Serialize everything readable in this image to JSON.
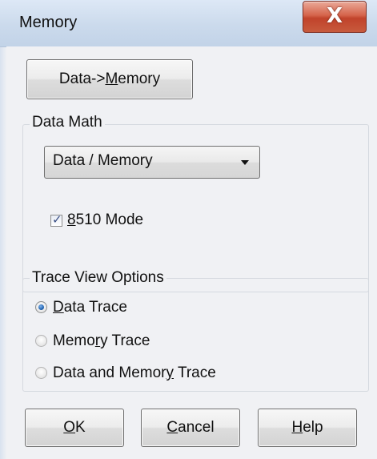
{
  "window": {
    "title": "Memory",
    "close_glyph": "X"
  },
  "data_to_memory_button": {
    "prefix": "Data->",
    "mnemonic": "M",
    "suffix": "emory"
  },
  "data_math": {
    "group_title": "Data Math",
    "dropdown_selected": "Data / Memory",
    "checkbox": {
      "checked": true,
      "check_glyph": "✓",
      "mnemonic": "8",
      "label_rest": "510 Mode"
    }
  },
  "trace_view": {
    "group_title": "Trace View Options",
    "options": [
      {
        "pre": "",
        "mnemonic": "D",
        "post": "ata Trace",
        "selected": true
      },
      {
        "pre": "Memo",
        "mnemonic": "r",
        "post": "y Trace",
        "selected": false
      },
      {
        "pre": "Data and Memor",
        "mnemonic": "y",
        "post": " Trace",
        "selected": false
      }
    ]
  },
  "buttons": {
    "ok": {
      "mnemonic": "O",
      "rest": "K"
    },
    "cancel": {
      "mnemonic": "C",
      "rest": "ancel"
    },
    "help": {
      "mnemonic": "H",
      "rest": "elp"
    }
  }
}
